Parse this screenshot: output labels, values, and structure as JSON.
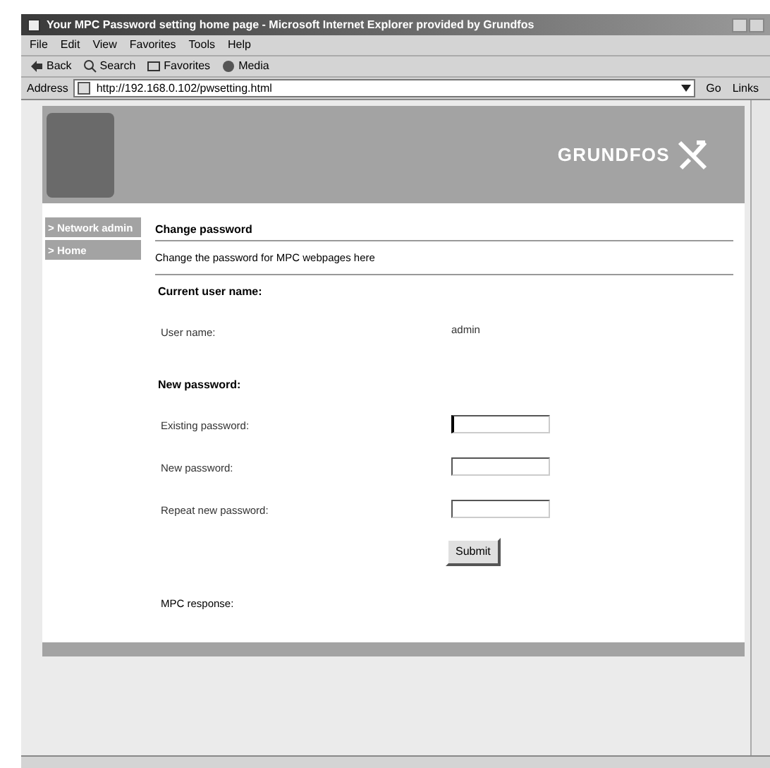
{
  "window": {
    "title": "Your MPC Password setting home page - Microsoft Internet Explorer provided by Grundfos"
  },
  "menu": [
    "File",
    "Edit",
    "View",
    "Favorites",
    "Tools",
    "Help"
  ],
  "toolbar": [
    {
      "kind": "back",
      "label": "Back"
    },
    {
      "kind": "search",
      "label": "Search"
    },
    {
      "kind": "favorites",
      "label": "Favorites"
    },
    {
      "kind": "media",
      "label": "Media"
    }
  ],
  "address": {
    "label": "Address",
    "url": "http://192.168.0.102/pwsetting.html",
    "go": "Go",
    "links": "Links"
  },
  "page": {
    "logo": "GRUNDFOS",
    "nav": [
      {
        "label": "> Network admin"
      },
      {
        "label": "> Home"
      }
    ],
    "heading": "Change password",
    "description": "Change the password for MPC webpages here",
    "sections": [
      {
        "title": "Current user name:",
        "rows": [
          {
            "kind": "value",
            "label": "User name:",
            "value": "admin"
          }
        ]
      },
      {
        "title": "New password:",
        "rows": [
          {
            "kind": "input",
            "label": "Existing password:",
            "focused": true
          },
          {
            "kind": "input",
            "label": "New password:",
            "focused": false
          },
          {
            "kind": "input",
            "label": "Repeat new password:",
            "focused": false
          }
        ]
      }
    ],
    "submit": "Submit",
    "response_label": "MPC response:"
  }
}
